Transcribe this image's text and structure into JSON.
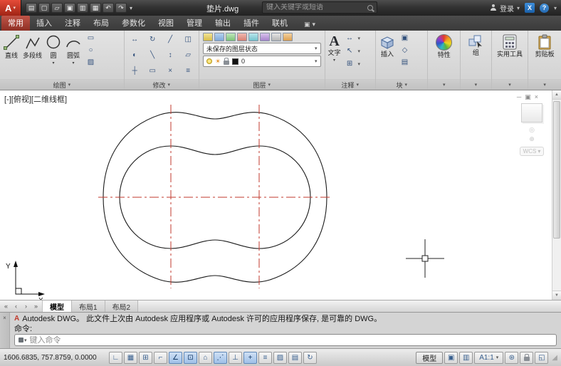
{
  "icons": {
    "app_logo": "A",
    "caret": "▾",
    "close": "×",
    "minimize": "─",
    "restore": "▣",
    "scroll_up": "▲",
    "scroll_down": "▼",
    "nav_first": "«",
    "nav_prev": "‹",
    "nav_next": "›",
    "nav_last": "»",
    "help": "?",
    "exchange": "X",
    "sun": "☀",
    "nav_wheel": "◎",
    "nav_pan": "⊕",
    "grip": "◢"
  },
  "titlebar": {
    "title": "垫片.dwg",
    "search_placeholder": "键入关键字或短语",
    "signin_label": "登录"
  },
  "qat_icons": [
    {
      "name": "workspace-icon",
      "glyph": "▤"
    },
    {
      "name": "new-file-icon",
      "glyph": "▢"
    },
    {
      "name": "open-file-icon",
      "glyph": "▱"
    },
    {
      "name": "save-icon",
      "glyph": "▣"
    },
    {
      "name": "save-as-icon",
      "glyph": "▥"
    },
    {
      "name": "plot-icon",
      "glyph": "▦"
    },
    {
      "name": "undo-icon",
      "glyph": "↶"
    },
    {
      "name": "redo-icon",
      "glyph": "↷"
    }
  ],
  "tabs": [
    {
      "label": "常用",
      "active": true
    },
    {
      "label": "插入",
      "active": false
    },
    {
      "label": "注释",
      "active": false
    },
    {
      "label": "布局",
      "active": false
    },
    {
      "label": "参数化",
      "active": false
    },
    {
      "label": "视图",
      "active": false
    },
    {
      "label": "管理",
      "active": false
    },
    {
      "label": "输出",
      "active": false
    },
    {
      "label": "插件",
      "active": false
    },
    {
      "label": "联机",
      "active": false
    }
  ],
  "panels": {
    "draw": {
      "title": "绘图",
      "tools": [
        "直线",
        "多段线",
        "圆",
        "圆弧"
      ],
      "side_tools": [
        {
          "name": "rectangle-tool",
          "glyph": "▭"
        },
        {
          "name": "ellipse-tool",
          "glyph": "○"
        },
        {
          "name": "hatch-tool",
          "glyph": "▨"
        }
      ]
    },
    "modify": {
      "title": "修改",
      "tools": [
        {
          "name": "move-tool",
          "glyph": "↔"
        },
        {
          "name": "rotate-tool",
          "glyph": "↻"
        },
        {
          "name": "trim-tool",
          "glyph": "╱"
        },
        {
          "name": "copy-tool",
          "glyph": "◫"
        },
        {
          "name": "mirror-tool",
          "glyph": "◐"
        },
        {
          "name": "fillet-tool",
          "glyph": "╲"
        },
        {
          "name": "stretch-tool",
          "glyph": "↕"
        },
        {
          "name": "scale-tool",
          "glyph": "▱"
        },
        {
          "name": "array-tool",
          "glyph": "┼"
        },
        {
          "name": "erase-tool",
          "glyph": "▭"
        },
        {
          "name": "explode-tool",
          "glyph": "×"
        },
        {
          "name": "offset-tool",
          "glyph": "≡"
        }
      ]
    },
    "layers": {
      "title": "图层",
      "state": "未保存的图层状态",
      "current": "0"
    },
    "annotation": {
      "title": "注释",
      "text_tool": "文字",
      "tools": [
        {
          "name": "dimension-tool",
          "glyph": "↔"
        },
        {
          "name": "leader-tool",
          "glyph": "↖"
        },
        {
          "name": "table-tool",
          "glyph": "⊞"
        }
      ]
    },
    "block": {
      "title": "块",
      "insert_tool": "插入",
      "tools": [
        {
          "name": "create-block-tool",
          "glyph": "▣"
        },
        {
          "name": "edit-block-tool",
          "glyph": "◇"
        },
        {
          "name": "block-attributes-tool",
          "glyph": "▤"
        }
      ]
    },
    "properties": {
      "title": "特性"
    },
    "groups": {
      "title": "组"
    },
    "utilities": {
      "title": "实用工具"
    },
    "clipboard": {
      "title": "剪贴板"
    }
  },
  "canvas": {
    "viewport_label": "[-][俯视][二维线框]",
    "wcs_label": "WCS",
    "axis_x_label": "X",
    "axis_y_label": "Y",
    "outline_color": "#1a1a1a",
    "centerline_color": "#c23a2e"
  },
  "layout_tabs": [
    {
      "label": "模型",
      "active": true
    },
    {
      "label": "布局1",
      "active": false
    },
    {
      "label": "布局2",
      "active": false
    }
  ],
  "command": {
    "history_line1": "Autodesk DWG。  此文件上次由 Autodesk 应用程序或 Autodesk 许可的应用程序保存, 是可靠的 DWG。",
    "history_line2": "命令:",
    "input_placeholder": "键入命令"
  },
  "statusbar": {
    "coordinates": "1606.6835, 757.8759, 0.0000",
    "toggles": [
      {
        "name": "infer-constraints-toggle",
        "glyph": "∟",
        "active": false
      },
      {
        "name": "snap-mode-toggle",
        "glyph": "▦",
        "active": false
      },
      {
        "name": "grid-display-toggle",
        "glyph": "⊞",
        "active": false
      },
      {
        "name": "ortho-mode-toggle",
        "glyph": "⌐",
        "active": false
      },
      {
        "name": "polar-tracking-toggle",
        "glyph": "∠",
        "active": true
      },
      {
        "name": "object-snap-toggle",
        "glyph": "⊡",
        "active": true
      },
      {
        "name": "3d-object-snap-toggle",
        "glyph": "⌂",
        "active": false
      },
      {
        "name": "object-snap-tracking-toggle",
        "glyph": "⋰",
        "active": true
      },
      {
        "name": "dynamic-ucs-toggle",
        "glyph": "⊥",
        "active": false
      },
      {
        "name": "dynamic-input-toggle",
        "glyph": "+",
        "active": true
      },
      {
        "name": "lineweight-toggle",
        "glyph": "≡",
        "active": false
      },
      {
        "name": "transparency-toggle",
        "glyph": "▨",
        "active": false
      },
      {
        "name": "quick-properties-toggle",
        "glyph": "▤",
        "active": false
      },
      {
        "name": "selection-cycling-toggle",
        "glyph": "↻",
        "active": false
      }
    ],
    "model_button": "模型",
    "annotation_scale": "A1:1",
    "right_icons": [
      {
        "name": "quick-view-layouts-icon",
        "glyph": "▣"
      },
      {
        "name": "quick-view-drawings-icon",
        "glyph": "▥"
      },
      {
        "name": "workspace-switch-icon",
        "glyph": "⊛"
      },
      {
        "name": "clean-screen-icon",
        "glyph": "◱"
      }
    ]
  }
}
